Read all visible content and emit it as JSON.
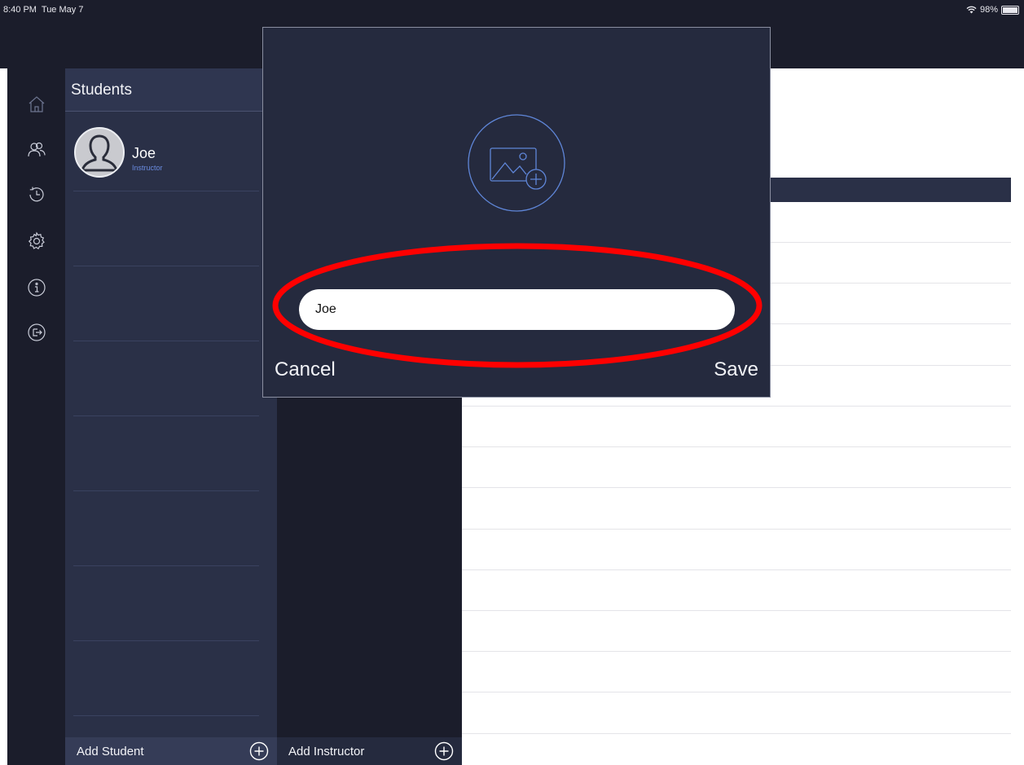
{
  "status_bar": {
    "time": "8:40 PM  Tue May 7",
    "battery": "98%",
    "battery_level": 0.98
  },
  "left_rail": {
    "icons": [
      "home-icon",
      "users-icon",
      "history-icon",
      "gear-icon",
      "info-icon",
      "logout-icon"
    ]
  },
  "students_panel": {
    "title": "Students",
    "items": [
      {
        "name": "Joe",
        "role": "Instructor"
      }
    ],
    "add_label": "Add Student"
  },
  "instructors_panel": {
    "add_label": "Add Instructor"
  },
  "modal": {
    "photo_icon": "add-photo-icon",
    "name_value": "Joe",
    "cancel_label": "Cancel",
    "save_label": "Save"
  },
  "annotation": {
    "color": "#ff0000"
  },
  "colors": {
    "rail_bg": "#1b1d2b",
    "panel_bg": "#2a3047",
    "modal_bg": "#252a3e",
    "accent": "#6a8be0"
  }
}
